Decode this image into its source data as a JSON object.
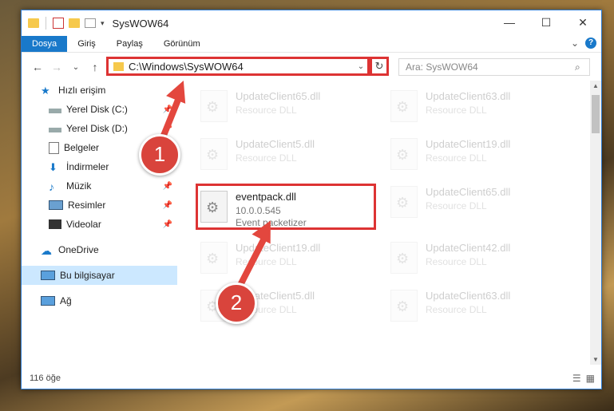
{
  "window": {
    "title": "SysWOW64"
  },
  "titlebar": {
    "minimize": "—",
    "maximize": "☐",
    "close": "✕"
  },
  "ribbon": {
    "tabs": [
      "Dosya",
      "Giriş",
      "Paylaş",
      "Görünüm"
    ],
    "expand": "⌄",
    "help": "?"
  },
  "navbar": {
    "back": "←",
    "forward": "→",
    "recent": "⌄",
    "up": "↑",
    "address": "C:\\Windows\\SysWOW64",
    "address_dropdown": "⌄",
    "refresh": "↻",
    "search_placeholder": "Ara: SysWOW64",
    "search_icon": "⌕"
  },
  "nav_pane": [
    {
      "label": "Hızlı erişim",
      "icon": "star-icon",
      "pinned": false
    },
    {
      "label": "Yerel Disk (C:)",
      "icon": "drive-icon",
      "pinned": true
    },
    {
      "label": "Yerel Disk (D:)",
      "icon": "drive-icon",
      "pinned": true
    },
    {
      "label": "Belgeler",
      "icon": "document-icon",
      "pinned": true
    },
    {
      "label": "İndirmeler",
      "icon": "download-icon",
      "pinned": true
    },
    {
      "label": "Müzik",
      "icon": "music-icon",
      "pinned": true
    },
    {
      "label": "Resimler",
      "icon": "picture-icon",
      "pinned": true
    },
    {
      "label": "Videolar",
      "icon": "video-icon",
      "pinned": true
    },
    {
      "label": "OneDrive",
      "icon": "cloud-icon",
      "pinned": false
    },
    {
      "label": "Bu bilgisayar",
      "icon": "computer-icon",
      "pinned": false
    },
    {
      "label": "Ağ",
      "icon": "network-icon",
      "pinned": false
    }
  ],
  "files": [
    {
      "name": "UpdateClient65.dll",
      "type": "Resource DLL"
    },
    {
      "name": "UpdateClient63.dll",
      "type": "Resource DLL"
    },
    {
      "name": "UpdateClient5.dll",
      "type": "Resource DLL"
    },
    {
      "name": "UpdateClient19.dll",
      "type": "Resource DLL"
    },
    {
      "name": "eventpack.dll",
      "version": "10.0.0.545",
      "type": "Event packetizer"
    },
    {
      "name": "UpdateClient65.dll",
      "type": "Resource DLL"
    },
    {
      "name": "UpdateClient19.dll",
      "type": "Resource DLL"
    },
    {
      "name": "UpdateClient42.dll",
      "type": "Resource DLL"
    },
    {
      "name": "UpdateClient5.dll",
      "type": "Resource DLL"
    },
    {
      "name": "UpdateClient63.dll",
      "type": "Resource DLL"
    }
  ],
  "status": {
    "count": "116 öğe"
  },
  "annotations": {
    "badge1": "1",
    "badge2": "2"
  },
  "colors": {
    "accent": "#1979ca",
    "highlight": "#d33333",
    "selection": "#cce8ff"
  }
}
